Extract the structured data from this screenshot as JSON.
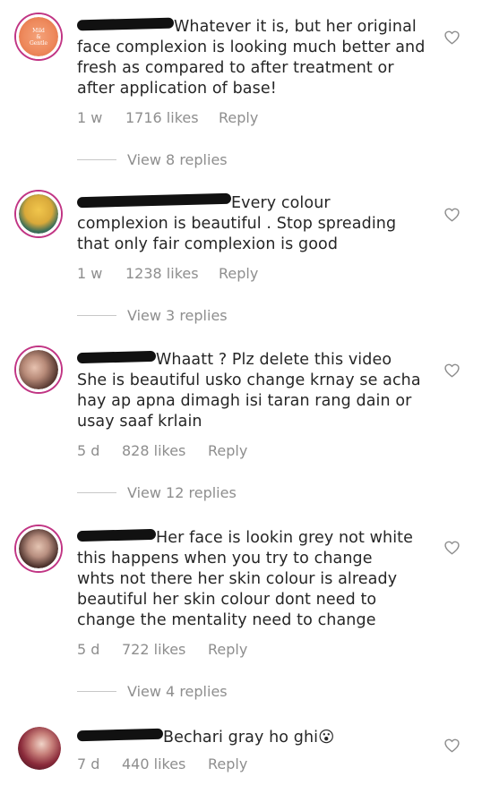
{
  "comments": [
    {
      "text_first": "Whatever it is, but her original",
      "text_rest": [
        "face complexion is looking much better and",
        "fresh as compared to after treatment or",
        "after application of base!"
      ],
      "time": "1 w",
      "likes": "1716 likes",
      "reply": "Reply",
      "view_replies": "View 8 replies",
      "avatar_text": [
        "Mild",
        "&",
        "Gentle"
      ]
    },
    {
      "text_first": "Every colour",
      "text_rest": [
        "complexion is beautiful . Stop spreading",
        "that only fair complexion is good"
      ],
      "time": "1 w",
      "likes": "1238 likes",
      "reply": "Reply",
      "view_replies": "View 3 replies"
    },
    {
      "text_first": "Whaatt ? Plz delete this video",
      "text_rest": [
        "She is beautiful usko change krnay se acha",
        "hay ap apna dimagh isi taran rang dain or",
        "usay saaf krlain"
      ],
      "time": "5 d",
      "likes": "828 likes",
      "reply": "Reply",
      "view_replies": "View 12 replies"
    },
    {
      "text_first": "Her face is lookin grey not white",
      "text_rest": [
        "this happens when you try to change",
        "whts not there her skin colour is already",
        "beautiful her skin colour dont need to",
        "change the mentality need to change"
      ],
      "time": "5 d",
      "likes": "722 likes",
      "reply": "Reply",
      "view_replies": "View 4 replies"
    },
    {
      "text_first": "Bechari gray ho ghi😮",
      "text_rest": [],
      "time": "7 d",
      "likes": "440 likes",
      "reply": "Reply"
    }
  ],
  "colors": {
    "text": "#262626",
    "muted": "#8e8e8e",
    "story_ring": "#c13584",
    "redaction": "#111111"
  },
  "icons": {
    "like": "heart-outline-icon"
  }
}
